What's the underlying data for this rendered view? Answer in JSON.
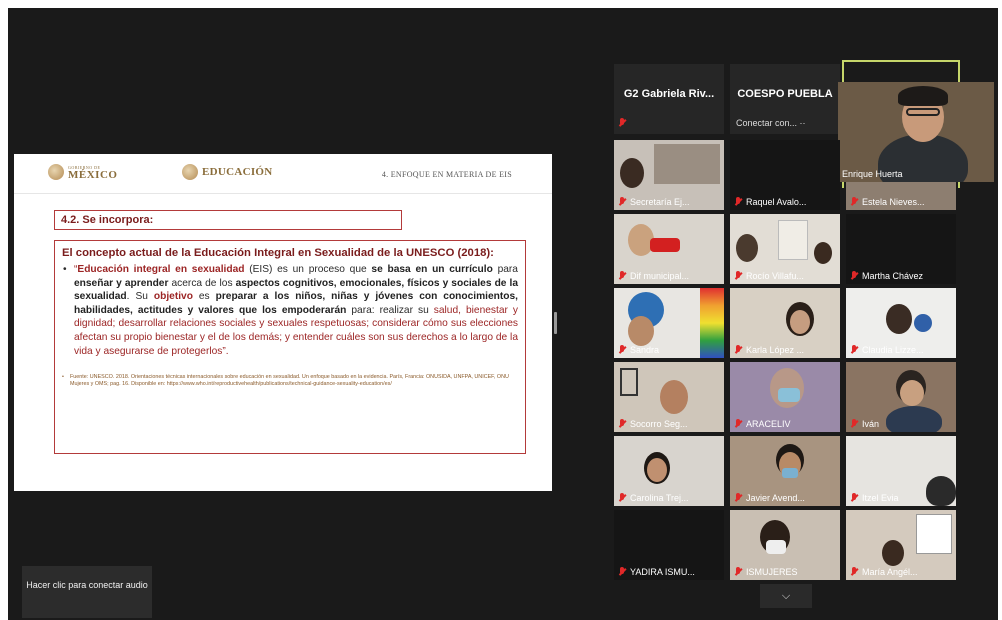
{
  "slide": {
    "logo_gob_small": "GOBIERNO DE",
    "logo_gob_big": "MÉXICO",
    "logo_edu": "EDUCACIÓN",
    "section_title": "4. ENFOQUE EN MATERIA DE EIS",
    "subheading": "4.2. Se incorpora:",
    "content_title": "El concepto actual de la Educación Integral en Sexualidad de la UNESCO (2018):",
    "bullet": {
      "q_open": "“",
      "b1": "Educación integral en sexualidad",
      "t1": " (EIS) es un proceso que ",
      "b2": "se basa en un currículo",
      "t2": " para ",
      "b3": "enseñar y aprender",
      "t3": " acerca de los ",
      "b4": "aspectos cognitivos, emocionales, físicos y sociales de la sexualidad",
      "t4": ". Su ",
      "b5": "objetivo",
      "t5": " es ",
      "b6": "preparar a los niños, niñas y jóvenes con conocimientos, habilidades, actitudes y valores que los empoderarán",
      "t6": " para: realizar su ",
      "red1": "salud, bienestar y dignidad; desarrollar relaciones sociales y sexuales respetuosas; considerar cómo sus elecciones afectan su propio bienestar y el de los demás; y entender cuáles son sus derechos a lo largo de la vida y asegurarse de protegerlos",
      "q_close": "”."
    },
    "footnote": "Fuente: UNESCO. 2018. Orientaciones técnicas internacionales sobre educación en sexualidad. Un enfoque basado en la evidencia. París, Francia: ONUSIDA, UNFPA, UNICEF, ONU Mujeres y OMS; pag. 16. Disponible en: https://www.who.int/reproductivehealth/publications/technical-guidance-sexuality-education/es/"
  },
  "gallery": {
    "name_tiles": [
      {
        "title": "G2  Gabriela Riv...",
        "sub": ""
      },
      {
        "title": "COESPO PUEBLA",
        "sub": "Conectar con... ··"
      }
    ],
    "speaker": {
      "name": "Enrique Huerta"
    },
    "tiles": [
      {
        "name": "Secretaría Ej..."
      },
      {
        "name": "Raquel Avalo..."
      },
      {
        "name": "Estela Nieves..."
      },
      {
        "name": "Dif municipal..."
      },
      {
        "name": "Rocío Villafu..."
      },
      {
        "name": "Martha Chávez"
      },
      {
        "name": "Sandra"
      },
      {
        "name": "Karla López ..."
      },
      {
        "name": "Claudia Lizze..."
      },
      {
        "name": "Socorro Seg..."
      },
      {
        "name": "ARACELIV"
      },
      {
        "name": "Iván"
      },
      {
        "name": "Carolina Trej..."
      },
      {
        "name": "Javier Avend..."
      },
      {
        "name": "Itzel Evia"
      },
      {
        "name": "YADIRA ISMU..."
      },
      {
        "name": "ISMUJERES"
      },
      {
        "name": "María Angél..."
      }
    ]
  },
  "controls": {
    "audio_button": "Hacer clic para conectar audio",
    "expand_icon": "chevron-down-icon",
    "expand_glyph": "⌵"
  },
  "colors": {
    "background": "#1a1a1a",
    "active_speaker": "#c6d66a",
    "muted_mic": "#e02828",
    "slide_accent": "#9c2525"
  }
}
